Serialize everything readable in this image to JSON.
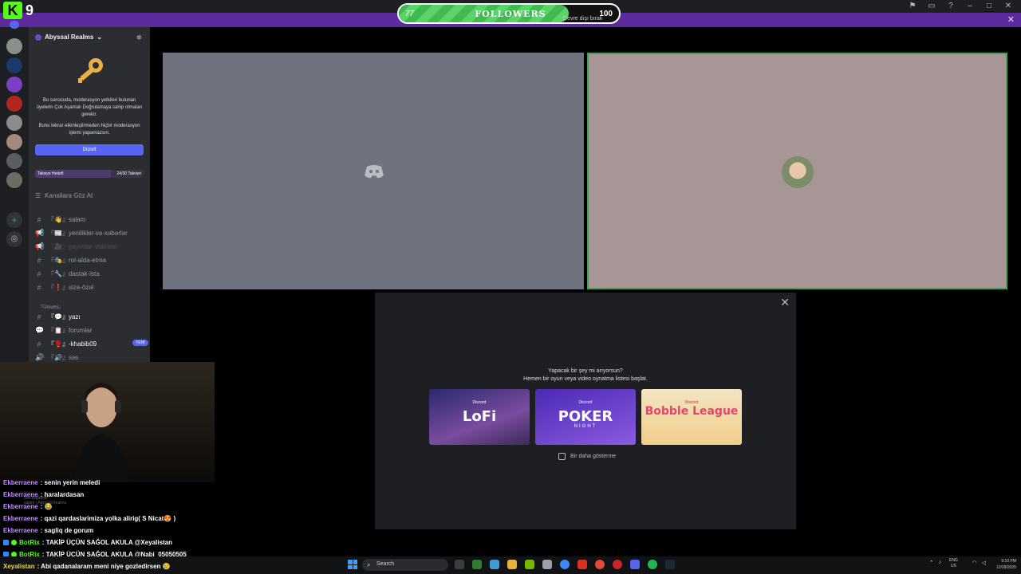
{
  "kick": {
    "logo_letter": "K",
    "viewer_count": "9"
  },
  "followers_goal": {
    "current": "77",
    "label": "FOLLOWERS",
    "target": "100",
    "subtext": "Devre dışı bırak",
    "progress_fraction": 0.77,
    "fill_color": "#3fb950"
  },
  "accent_colors": {
    "discord_blurple": "#5865f2",
    "kick_green": "#53fc18",
    "speaking_green": "#3ba55d",
    "purple_banner": "#5c2a9d"
  },
  "server": {
    "name": "Abyssal Realms"
  },
  "mfa_notice": {
    "message": "Bu sunucuda, moderasyon yetkileri bulunan üyelerin Çok Aşamalı Doğrulamaya sahip olmaları gerekir.",
    "warning": "Bunu tekrar etkinleştirmeden hiçbir moderasyon işlemi yapamazsın.",
    "button": "Düzelt"
  },
  "boost": {
    "label": "Takviye Hedefi",
    "count": "24/30 Takviye"
  },
  "browse_channels": "Kanallara Göz At",
  "channels": [
    {
      "icon": "#",
      "label": "『👋』salam"
    },
    {
      "icon": "📢",
      "label": "『📰』yenilikler-və-xəbərlər"
    },
    {
      "icon": "📢",
      "label": "『🎥』yayımlar-videolar"
    },
    {
      "icon": "#",
      "label": "『🎭』rol-alda-etma"
    },
    {
      "icon": "#",
      "label": "『🔧』dastak-ista"
    },
    {
      "icon": "#",
      "label": "『❗』siza-özəl"
    }
  ],
  "category": "『Ümumi』",
  "channels2": [
    {
      "icon": "#",
      "label": "『💬』yazı"
    },
    {
      "icon": "💬",
      "label": "『📋』forumlar"
    },
    {
      "icon": "#",
      "label": "『🥊』-khabib09",
      "badge": "YENİ"
    },
    {
      "icon": "🔊",
      "label": "『🔊』səs"
    }
  ],
  "activity": {
    "question": "Yapacak bir şey mi arıyorsun?",
    "subtitle": "Hemen bir oyun veya video oynatma listesi başlat.",
    "cards": [
      {
        "brand": "Discord",
        "title": "LoFi",
        "sub": ""
      },
      {
        "brand": "Discord",
        "title": "POKER",
        "sub": "NIGHT"
      },
      {
        "brand": "Discord",
        "title": "Bobble League",
        "sub": ""
      }
    ],
    "dont_show": "Bir daha gösterme"
  },
  "user_panel": {
    "status": "Ses Bağlandı",
    "channel": "salam / Abyssal Realms"
  },
  "chat": [
    {
      "user": "Ekberraene",
      "text": ": senin yerin meledi",
      "color": "purple"
    },
    {
      "user": "Ekberraene",
      "text": ": haralardasan",
      "color": "purple"
    },
    {
      "user": "Ekberraene",
      "text": ": 😂",
      "color": "purple"
    },
    {
      "user": "Ekberraene",
      "text": ": qazi qardaslarimiza yolka alirig( S Nicat😍 )",
      "color": "purple"
    },
    {
      "user": "Ekberraene",
      "text": ": sagliq de gorum",
      "color": "purple"
    },
    {
      "user": "BotRix",
      "text": ": TAKİP ÜÇÜN SAĞOL AKULA @Xeyalistan",
      "color": "green"
    },
    {
      "user": "BotRix",
      "text": ": TAKİP ÜÇÜN SAĞOL AKULA @Nabi_05050505",
      "color": "green"
    },
    {
      "user": "Xeyalistan",
      "text": ": Abi qadanalaram meni niye gozledirsen 😢",
      "color": "yellow"
    }
  ],
  "taskbar": {
    "search": "Search",
    "lang": "ENG",
    "region": "US",
    "time": "9:10 PM",
    "date": "12/28/2025"
  }
}
